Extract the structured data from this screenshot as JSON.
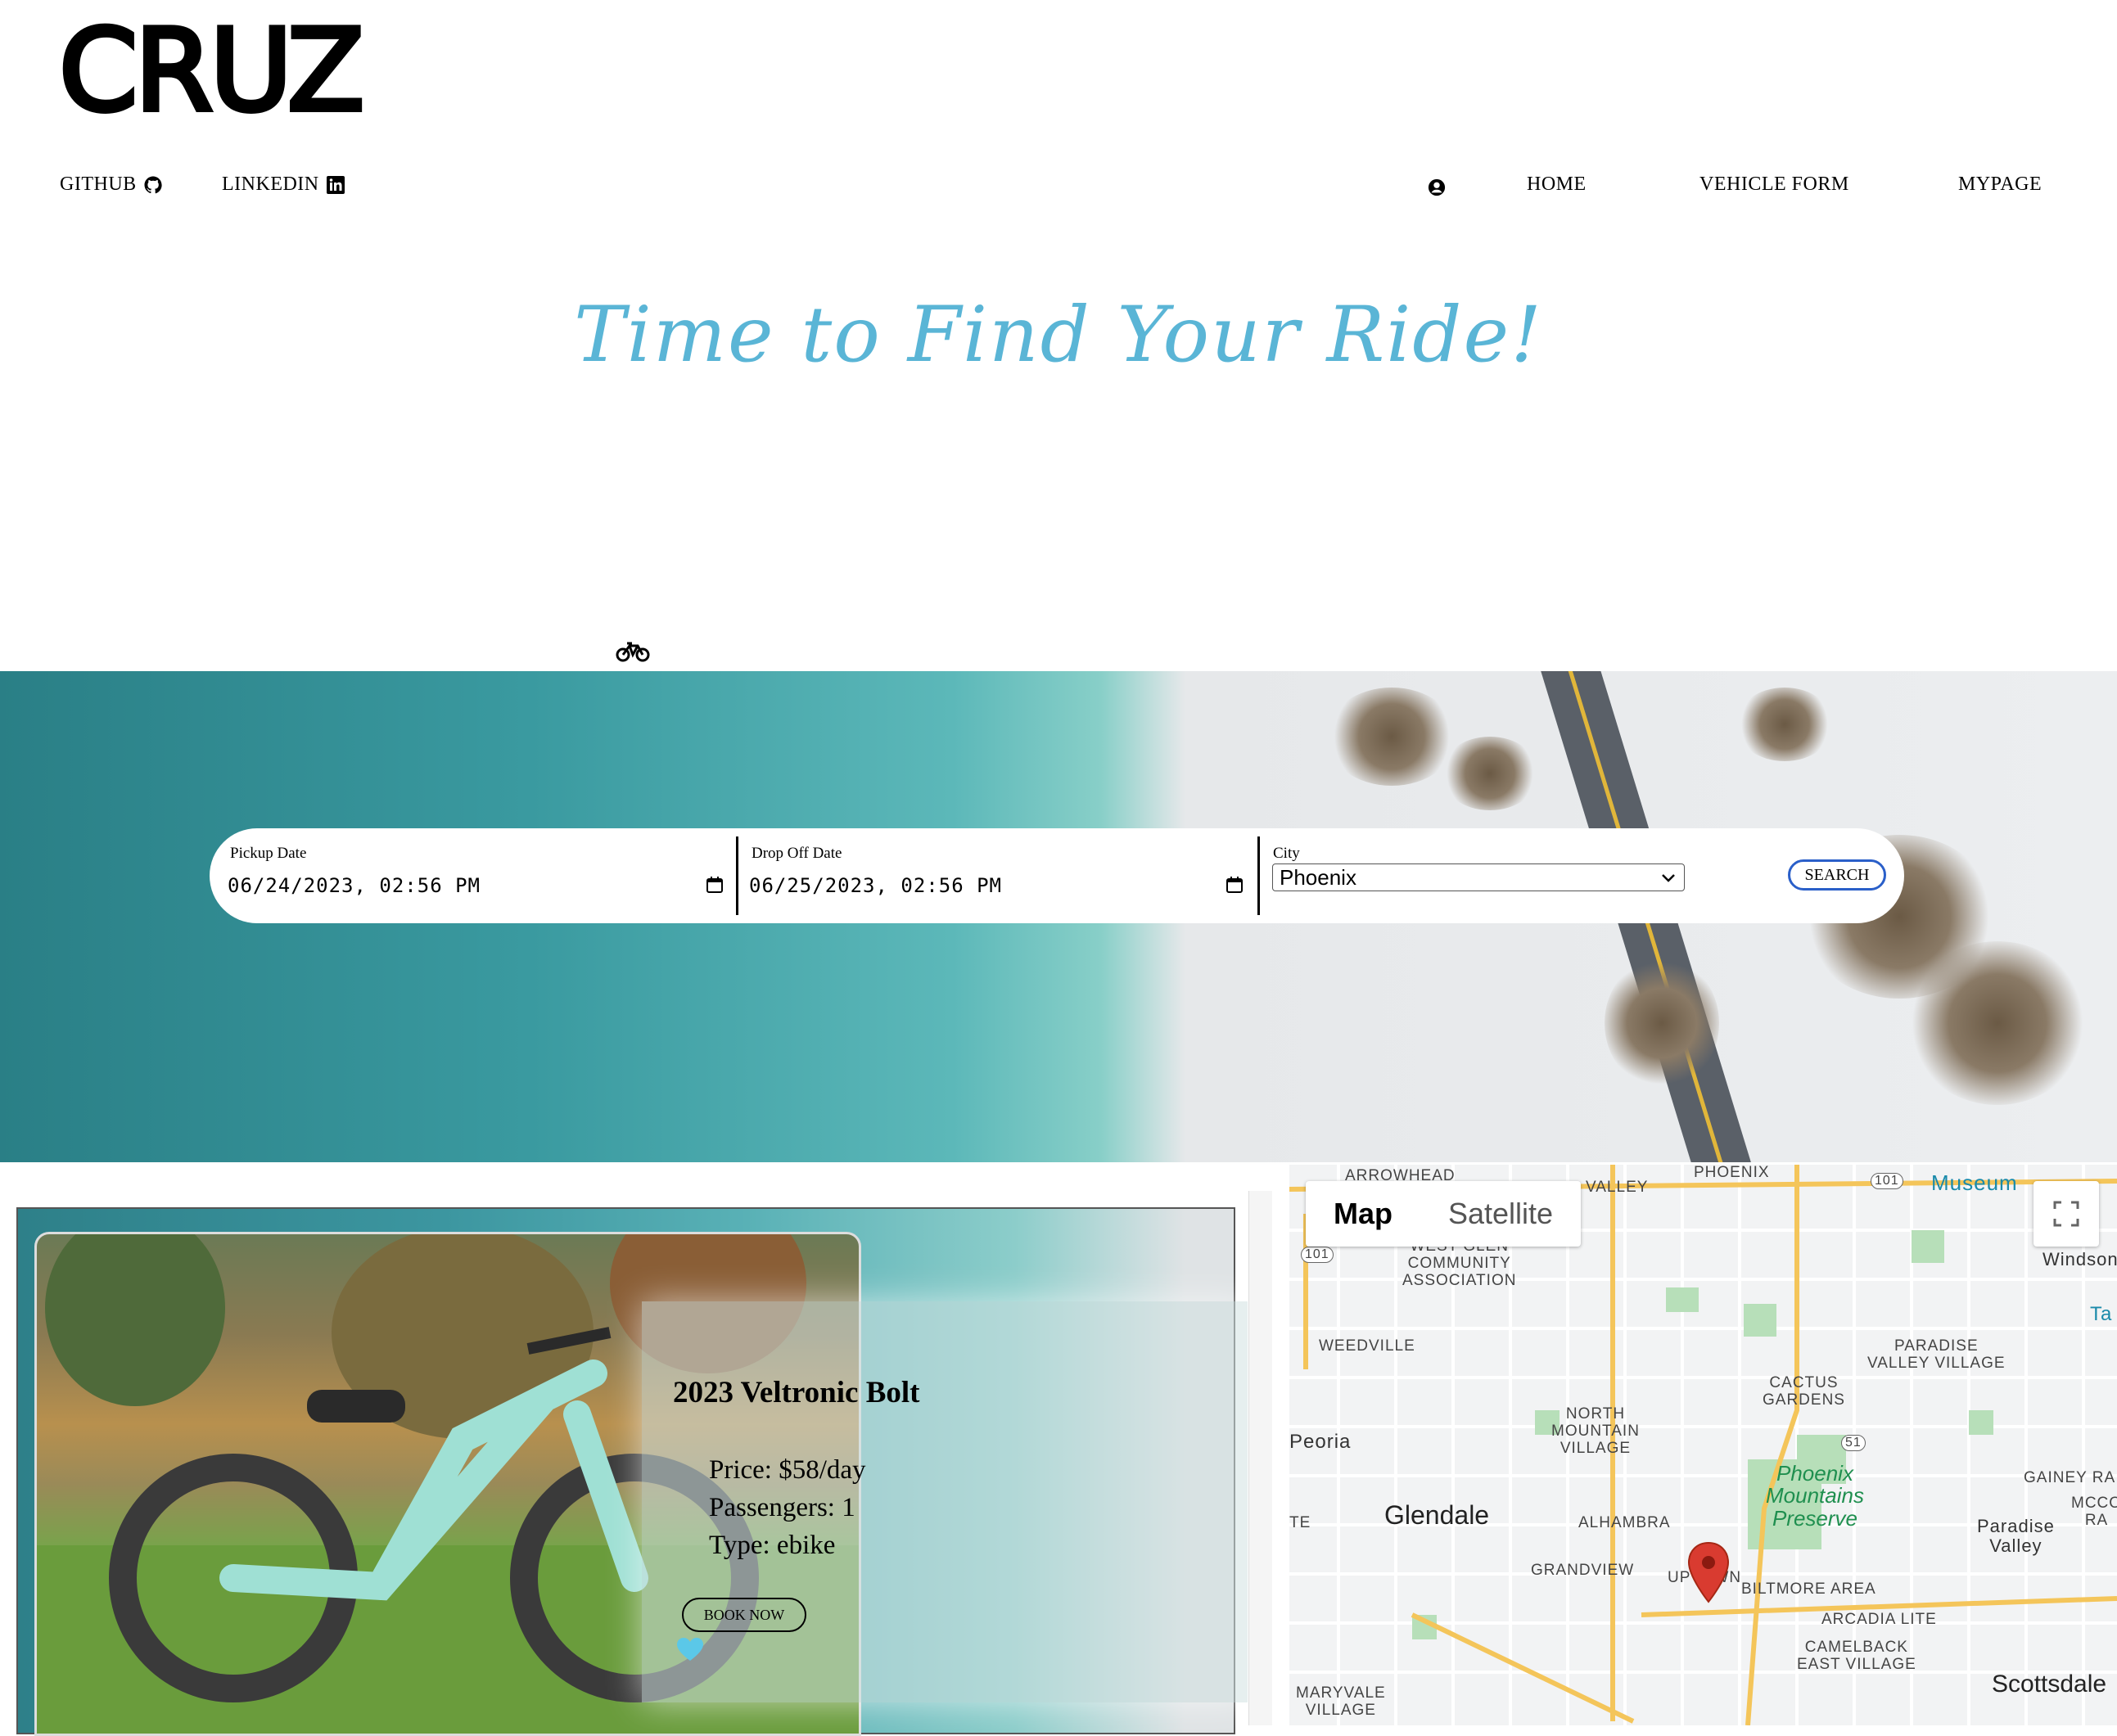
{
  "brand": {
    "logo": "CRUZ"
  },
  "nav_left": [
    {
      "label": "GITHUB",
      "icon": "github-icon"
    },
    {
      "label": "LINKEDIN",
      "icon": "linkedin-icon"
    }
  ],
  "nav_right": {
    "home": "HOME",
    "vehicle_form": "VEHICLE FORM",
    "mypage": "MYPAGE"
  },
  "hero": {
    "headline": "Time to Find Your Ride!"
  },
  "search": {
    "pickup_label": "Pickup Date",
    "pickup_value": "06/24/2023, 02:56 PM",
    "dropoff_label": "Drop Off Date",
    "dropoff_value": "06/25/2023, 02:56 PM",
    "city_label": "City",
    "city_value": "Phoenix",
    "search_label": "SEARCH"
  },
  "vehicle": {
    "title": "2023 Veltronic Bolt",
    "price": "Price: $58/day",
    "passengers": "Passengers: 1",
    "type": "Type: ebike",
    "book_label": "BOOK NOW"
  },
  "map": {
    "tabs": [
      "Map",
      "Satellite"
    ],
    "labels": {
      "arrowhead": "ARROWHEAD",
      "phoenix_top": "PHOENIX",
      "valley": "VALLEY",
      "museum": "Museum",
      "windsong": "Windsong",
      "west_glen": "WEST GLEN\nCOMMUNITY\nASSOCIATION",
      "weedville": "WEEDVILLE",
      "paradise_valley_village": "PARADISE\nVALLEY VILLAGE",
      "cactus_gardens": "CACTUS\nGARDENS",
      "north_mountain": "NORTH\nMOUNTAIN\nVILLAGE",
      "peoria": "Peoria",
      "glendale": "Glendale",
      "alhambra": "ALHAMBRA",
      "grandview": "GRANDVIEW",
      "uptown": "UPTOWN",
      "biltmore": "BILTMORE AREA",
      "arcadia": "ARCADIA LITE",
      "camelback": "CAMELBACK\nEAST VILLAGE",
      "maryvale": "MARYVALE\nVILLAGE",
      "paradise_valley": "Paradise\nValley",
      "scottsdale": "Scottsdale",
      "gainey": "GAINEY RA",
      "mccor": "MCCO\nRA",
      "ta": "Ta",
      "te": "TE",
      "phoenix_mountains": "Phoenix\nMountains\nPreserve",
      "route_101a": "101",
      "route_101b": "101",
      "route_51": "51"
    }
  },
  "colors": {
    "headline": "#5ab5d6",
    "search_border": "#2a5fc9",
    "heart": "#5bc8e8",
    "pin": "#d93b30"
  }
}
